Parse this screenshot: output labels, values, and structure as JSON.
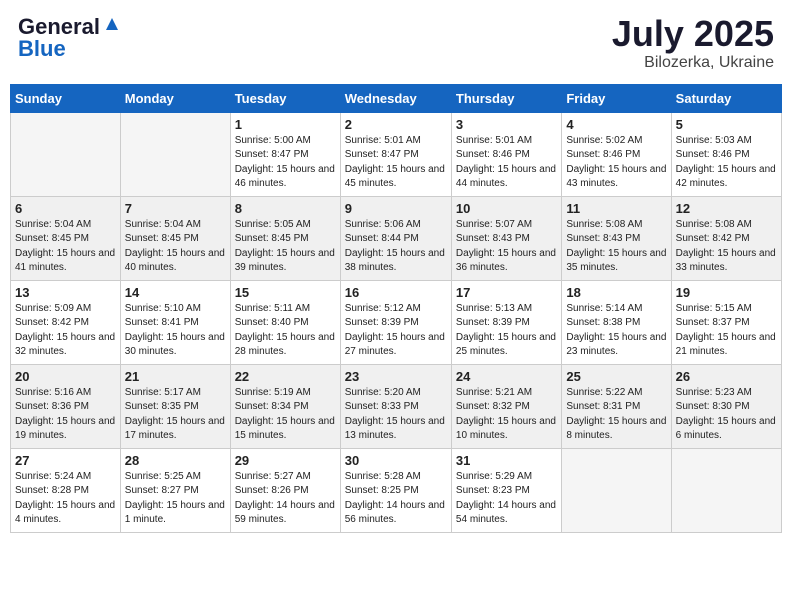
{
  "header": {
    "logo_general": "General",
    "logo_blue": "Blue",
    "title": "July 2025",
    "location": "Bilozerka, Ukraine"
  },
  "calendar": {
    "days_of_week": [
      "Sunday",
      "Monday",
      "Tuesday",
      "Wednesday",
      "Thursday",
      "Friday",
      "Saturday"
    ],
    "weeks": [
      [
        {
          "day": "",
          "empty": true
        },
        {
          "day": "",
          "empty": true
        },
        {
          "day": "1",
          "sunrise": "Sunrise: 5:00 AM",
          "sunset": "Sunset: 8:47 PM",
          "daylight": "Daylight: 15 hours and 46 minutes."
        },
        {
          "day": "2",
          "sunrise": "Sunrise: 5:01 AM",
          "sunset": "Sunset: 8:47 PM",
          "daylight": "Daylight: 15 hours and 45 minutes."
        },
        {
          "day": "3",
          "sunrise": "Sunrise: 5:01 AM",
          "sunset": "Sunset: 8:46 PM",
          "daylight": "Daylight: 15 hours and 44 minutes."
        },
        {
          "day": "4",
          "sunrise": "Sunrise: 5:02 AM",
          "sunset": "Sunset: 8:46 PM",
          "daylight": "Daylight: 15 hours and 43 minutes."
        },
        {
          "day": "5",
          "sunrise": "Sunrise: 5:03 AM",
          "sunset": "Sunset: 8:46 PM",
          "daylight": "Daylight: 15 hours and 42 minutes."
        }
      ],
      [
        {
          "day": "6",
          "sunrise": "Sunrise: 5:04 AM",
          "sunset": "Sunset: 8:45 PM",
          "daylight": "Daylight: 15 hours and 41 minutes."
        },
        {
          "day": "7",
          "sunrise": "Sunrise: 5:04 AM",
          "sunset": "Sunset: 8:45 PM",
          "daylight": "Daylight: 15 hours and 40 minutes."
        },
        {
          "day": "8",
          "sunrise": "Sunrise: 5:05 AM",
          "sunset": "Sunset: 8:45 PM",
          "daylight": "Daylight: 15 hours and 39 minutes."
        },
        {
          "day": "9",
          "sunrise": "Sunrise: 5:06 AM",
          "sunset": "Sunset: 8:44 PM",
          "daylight": "Daylight: 15 hours and 38 minutes."
        },
        {
          "day": "10",
          "sunrise": "Sunrise: 5:07 AM",
          "sunset": "Sunset: 8:43 PM",
          "daylight": "Daylight: 15 hours and 36 minutes."
        },
        {
          "day": "11",
          "sunrise": "Sunrise: 5:08 AM",
          "sunset": "Sunset: 8:43 PM",
          "daylight": "Daylight: 15 hours and 35 minutes."
        },
        {
          "day": "12",
          "sunrise": "Sunrise: 5:08 AM",
          "sunset": "Sunset: 8:42 PM",
          "daylight": "Daylight: 15 hours and 33 minutes."
        }
      ],
      [
        {
          "day": "13",
          "sunrise": "Sunrise: 5:09 AM",
          "sunset": "Sunset: 8:42 PM",
          "daylight": "Daylight: 15 hours and 32 minutes."
        },
        {
          "day": "14",
          "sunrise": "Sunrise: 5:10 AM",
          "sunset": "Sunset: 8:41 PM",
          "daylight": "Daylight: 15 hours and 30 minutes."
        },
        {
          "day": "15",
          "sunrise": "Sunrise: 5:11 AM",
          "sunset": "Sunset: 8:40 PM",
          "daylight": "Daylight: 15 hours and 28 minutes."
        },
        {
          "day": "16",
          "sunrise": "Sunrise: 5:12 AM",
          "sunset": "Sunset: 8:39 PM",
          "daylight": "Daylight: 15 hours and 27 minutes."
        },
        {
          "day": "17",
          "sunrise": "Sunrise: 5:13 AM",
          "sunset": "Sunset: 8:39 PM",
          "daylight": "Daylight: 15 hours and 25 minutes."
        },
        {
          "day": "18",
          "sunrise": "Sunrise: 5:14 AM",
          "sunset": "Sunset: 8:38 PM",
          "daylight": "Daylight: 15 hours and 23 minutes."
        },
        {
          "day": "19",
          "sunrise": "Sunrise: 5:15 AM",
          "sunset": "Sunset: 8:37 PM",
          "daylight": "Daylight: 15 hours and 21 minutes."
        }
      ],
      [
        {
          "day": "20",
          "sunrise": "Sunrise: 5:16 AM",
          "sunset": "Sunset: 8:36 PM",
          "daylight": "Daylight: 15 hours and 19 minutes."
        },
        {
          "day": "21",
          "sunrise": "Sunrise: 5:17 AM",
          "sunset": "Sunset: 8:35 PM",
          "daylight": "Daylight: 15 hours and 17 minutes."
        },
        {
          "day": "22",
          "sunrise": "Sunrise: 5:19 AM",
          "sunset": "Sunset: 8:34 PM",
          "daylight": "Daylight: 15 hours and 15 minutes."
        },
        {
          "day": "23",
          "sunrise": "Sunrise: 5:20 AM",
          "sunset": "Sunset: 8:33 PM",
          "daylight": "Daylight: 15 hours and 13 minutes."
        },
        {
          "day": "24",
          "sunrise": "Sunrise: 5:21 AM",
          "sunset": "Sunset: 8:32 PM",
          "daylight": "Daylight: 15 hours and 10 minutes."
        },
        {
          "day": "25",
          "sunrise": "Sunrise: 5:22 AM",
          "sunset": "Sunset: 8:31 PM",
          "daylight": "Daylight: 15 hours and 8 minutes."
        },
        {
          "day": "26",
          "sunrise": "Sunrise: 5:23 AM",
          "sunset": "Sunset: 8:30 PM",
          "daylight": "Daylight: 15 hours and 6 minutes."
        }
      ],
      [
        {
          "day": "27",
          "sunrise": "Sunrise: 5:24 AM",
          "sunset": "Sunset: 8:28 PM",
          "daylight": "Daylight: 15 hours and 4 minutes."
        },
        {
          "day": "28",
          "sunrise": "Sunrise: 5:25 AM",
          "sunset": "Sunset: 8:27 PM",
          "daylight": "Daylight: 15 hours and 1 minute."
        },
        {
          "day": "29",
          "sunrise": "Sunrise: 5:27 AM",
          "sunset": "Sunset: 8:26 PM",
          "daylight": "Daylight: 14 hours and 59 minutes."
        },
        {
          "day": "30",
          "sunrise": "Sunrise: 5:28 AM",
          "sunset": "Sunset: 8:25 PM",
          "daylight": "Daylight: 14 hours and 56 minutes."
        },
        {
          "day": "31",
          "sunrise": "Sunrise: 5:29 AM",
          "sunset": "Sunset: 8:23 PM",
          "daylight": "Daylight: 14 hours and 54 minutes."
        },
        {
          "day": "",
          "empty": true
        },
        {
          "day": "",
          "empty": true
        }
      ]
    ]
  }
}
